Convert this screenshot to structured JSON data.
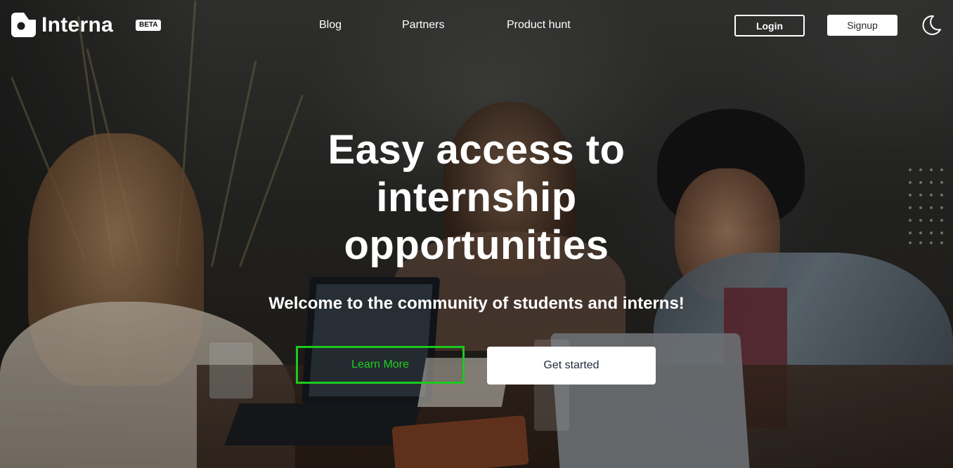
{
  "brand": {
    "name": "Interna",
    "badge": "BETA"
  },
  "nav": {
    "links": [
      {
        "label": "Blog"
      },
      {
        "label": "Partners"
      },
      {
        "label": "Product hunt"
      }
    ],
    "login_label": "Login",
    "signup_label": "Signup"
  },
  "hero": {
    "headline_lines": [
      "Easy access to",
      "internship",
      "opportunities"
    ],
    "subheadline": "Welcome to the community of students and interns!",
    "learn_more_label": "Learn More",
    "get_started_label": "Get started"
  },
  "colors": {
    "accent_green": "#1ec81e",
    "text_white": "#ffffff",
    "button_text_dark": "#1f2a3a"
  },
  "icons": {
    "logo": "interna-logo-icon",
    "theme": "moon-icon"
  }
}
